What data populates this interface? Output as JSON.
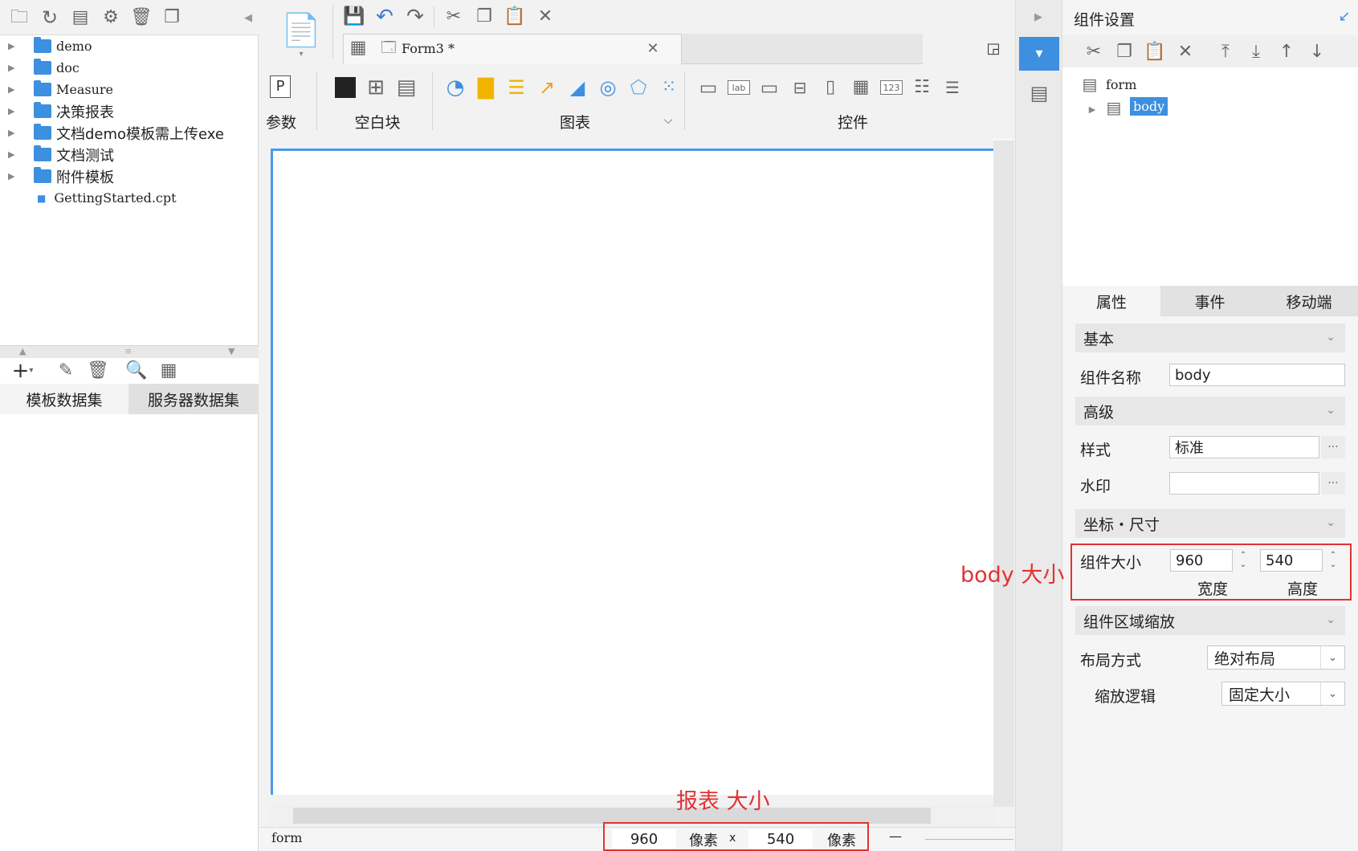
{
  "left_panel": {
    "toolbar_icons": [
      "new-folder-icon",
      "refresh-icon",
      "template-icon",
      "settings-gear-icon",
      "delete-icon",
      "copy-icon"
    ],
    "tree": [
      {
        "label": "demo",
        "type": "folder"
      },
      {
        "label": "doc",
        "type": "folder"
      },
      {
        "label": "Measure",
        "type": "folder"
      },
      {
        "label": "决策报表",
        "type": "folder"
      },
      {
        "label": "文档demo模板需上传exe",
        "type": "folder"
      },
      {
        "label": "文档测试",
        "type": "folder"
      },
      {
        "label": "附件模板",
        "type": "folder"
      },
      {
        "label": "GettingStarted.cpt",
        "type": "file"
      }
    ],
    "dataset_tabs": [
      "模板数据集",
      "服务器数据集"
    ]
  },
  "editor": {
    "tab_title": "Form3 *",
    "groups": {
      "params": "参数",
      "blank": "空白块",
      "chart": "图表",
      "widgets": "控件"
    }
  },
  "status": {
    "form_label": "form",
    "width": "960",
    "width_unit": "像素",
    "times": "x",
    "height": "540",
    "height_unit": "像素",
    "zoom_minus": "—"
  },
  "annotations": {
    "report_size": "报表 大小",
    "body_size": "body 大小"
  },
  "right_panel": {
    "title": "组件设置",
    "tree": {
      "root": "form",
      "child": "body"
    },
    "tabs": [
      "属性",
      "事件",
      "移动端"
    ],
    "sections": {
      "basic": "基本",
      "advanced": "高级",
      "coords": "坐标・尺寸",
      "scale": "组件区域缩放"
    },
    "fields": {
      "name_label": "组件名称",
      "name_value": "body",
      "style_label": "样式",
      "style_value": "标准",
      "watermark_label": "水印",
      "watermark_value": "",
      "size_label": "组件大小",
      "width_value": "960",
      "height_value": "540",
      "width_caption": "宽度",
      "height_caption": "高度",
      "layout_label": "布局方式",
      "layout_value": "绝对布局",
      "zoom_label": "缩放逻辑",
      "zoom_value": "固定大小",
      "ellipsis": "···"
    }
  },
  "colors": {
    "accent": "#4a9ae8",
    "annotation": "#e23232",
    "folder": "#3d8fe0"
  }
}
